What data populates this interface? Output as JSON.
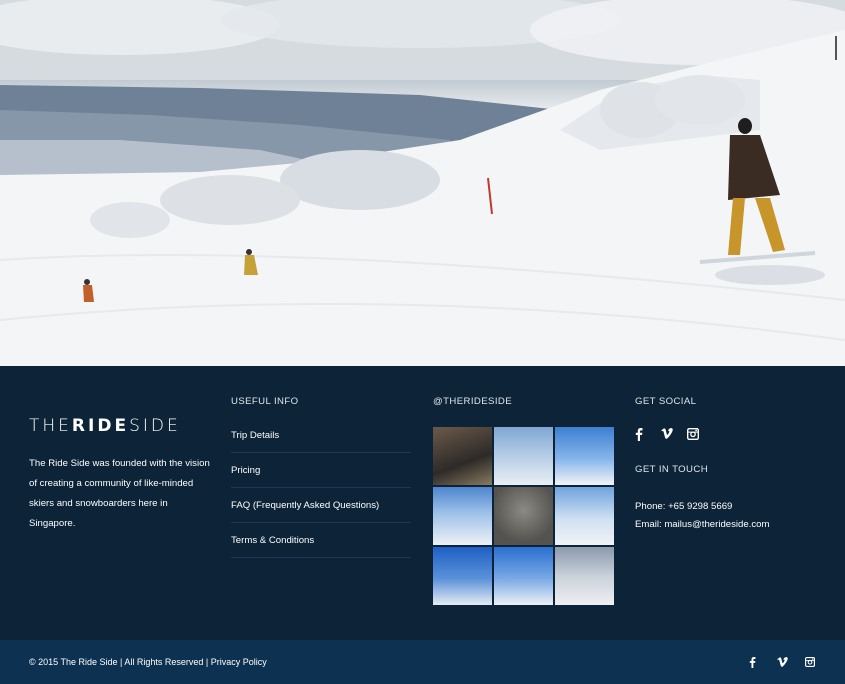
{
  "hero": {
    "alt": "Snowboarders on a ski slope"
  },
  "brand": {
    "part1": "THE",
    "part2": "RIDE",
    "part3": "SIDE"
  },
  "about": {
    "text": "The Ride Side was founded with the vision of creating a community of like-minded skiers and snowboarders here in Singapore."
  },
  "useful_info": {
    "title": "USEFUL INFO",
    "links": [
      {
        "label": "Trip Details"
      },
      {
        "label": "Pricing"
      },
      {
        "label": "FAQ (Frequently Asked Questions)"
      },
      {
        "label": "Terms & Conditions"
      }
    ]
  },
  "instagram": {
    "title": "@THERIDESIDE"
  },
  "social": {
    "title": "GET SOCIAL",
    "icons": [
      "facebook-icon",
      "vimeo-icon",
      "instagram-icon"
    ]
  },
  "touch": {
    "title": "GET IN TOUCH",
    "phone": "Phone: +65 9298 5669",
    "email": "Email: mailus@therideside.com"
  },
  "bottom": {
    "copyright": "© 2015 The Ride Side | All Rights Reserved | ",
    "privacy": "Privacy Policy"
  },
  "colors": {
    "footer_bg": "#0c2338",
    "bottom_bg": "#0d3150",
    "divider": "#1e3a52"
  }
}
